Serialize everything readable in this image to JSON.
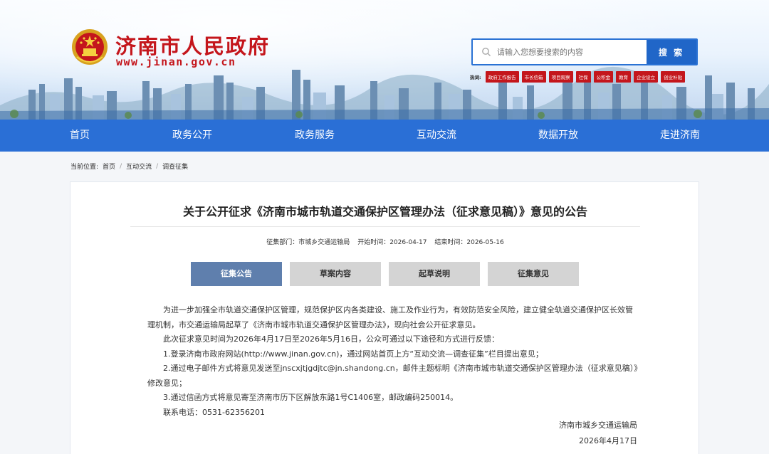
{
  "site": {
    "title": "济南市人民政府",
    "url": "www.jinan.gov.cn"
  },
  "search": {
    "placeholder": "请输入您想要搜索的内容",
    "button_label": "搜 索"
  },
  "hotwords": {
    "label": "热词:",
    "items": [
      "政府工作报告",
      "市长信箱",
      "项目观察",
      "社保",
      "公积金",
      "教育",
      "企业设立",
      "创业补贴"
    ]
  },
  "nav": {
    "items": [
      "首页",
      "政务公开",
      "政务服务",
      "互动交流",
      "数据开放",
      "走进济南"
    ]
  },
  "breadcrumb": {
    "prefix": "当前位置:",
    "items": [
      "首页",
      "互动交流",
      "调查征集"
    ],
    "separator": "/"
  },
  "article": {
    "title": "关于公开征求《济南市城市轨道交通保护区管理办法（征求意见稿）》意见的公告",
    "meta": {
      "department": "征集部门：市城乡交通运输局",
      "start": "开始时间：2026-04-17",
      "end": "结束时间：2026-05-16"
    },
    "tabs": [
      "征集公告",
      "草案内容",
      "起草说明",
      "征集意见"
    ],
    "active_tab": "征集公告",
    "paragraphs": [
      "为进一步加强全市轨道交通保护区管理，规范保护区内各类建设、施工及作业行为，有效防范安全风险，建立健全轨道交通保护区长效管理机制，市交通运输局起草了《济南市城市轨道交通保护区管理办法》，现向社会公开征求意见。",
      "此次征求意见时间为2026年4月17日至2026年5月16日，公众可通过以下途径和方式进行反馈：",
      "1.登录济南市政府网站(http://www.jinan.gov.cn)，通过网站首页上方“互动交流—调查征集”栏目提出意见；",
      "2.通过电子邮件方式将意见发送至jnscxjtjgdjtc@jn.shandong.cn，邮件主题标明《济南市城市轨道交通保护区管理办法（征求意见稿）》修改意见；",
      "3.通过信函方式将意见寄至济南市历下区解放东路1号C1406室，邮政编码250014。",
      "联系电话：0531-62356201"
    ],
    "signature": {
      "org": "济南市城乡交通运输局",
      "date": "2026年4月17日"
    }
  },
  "colors": {
    "brand_red": "#c4161c",
    "nav_blue": "#2a6fd6",
    "search_blue": "#2066c8",
    "tab_active": "#5f7fad",
    "tab_inactive": "#d4d4d4"
  }
}
